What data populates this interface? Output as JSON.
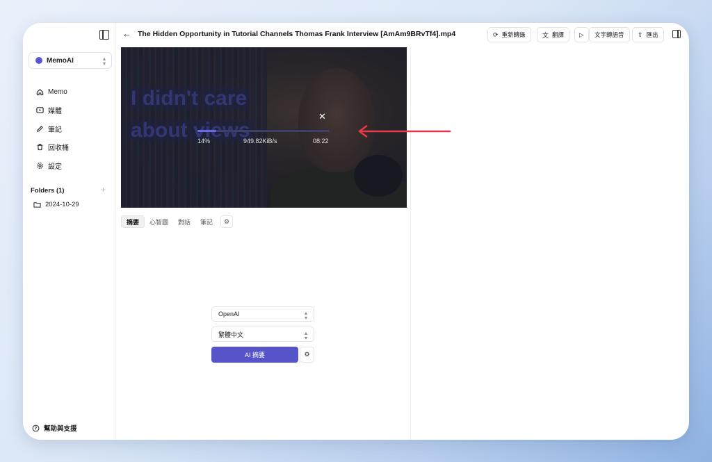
{
  "sidebar": {
    "app_name": "MemoAI",
    "nav": [
      {
        "label": "Memo",
        "icon": "home-icon"
      },
      {
        "label": "媒體",
        "icon": "play-square-icon"
      },
      {
        "label": "筆記",
        "icon": "pencil-icon"
      },
      {
        "label": "回收桶",
        "icon": "trash-icon"
      },
      {
        "label": "設定",
        "icon": "gear-icon"
      }
    ],
    "folders_title": "Folders (1)",
    "folders": [
      {
        "label": "2024-10-29",
        "icon": "folder-icon"
      }
    ],
    "help_label": "幫助與支援"
  },
  "header": {
    "title": "The Hidden Opportunity in Tutorial Channels Thomas Frank Interview [AmAm9BRvTf4].mp4",
    "buttons": {
      "retranscribe": "重新轉錄",
      "translate": "翻譯",
      "tts": "文字轉語音",
      "export": "匯出"
    }
  },
  "video": {
    "overlay_line1": "I didn't care",
    "overlay_line2": "about views",
    "progress_fraction": 0.14,
    "progress_text": "14%",
    "speed": "949.82KiB/s",
    "eta": "08:22"
  },
  "tabs": [
    "摘要",
    "心智圖",
    "對話",
    "筆記"
  ],
  "summary": {
    "provider": "OpenAI",
    "language": "繁體中文",
    "button": "AI 摘要"
  },
  "colors": {
    "accent": "#5654c8",
    "annotation_arrow": "#e8394a"
  }
}
